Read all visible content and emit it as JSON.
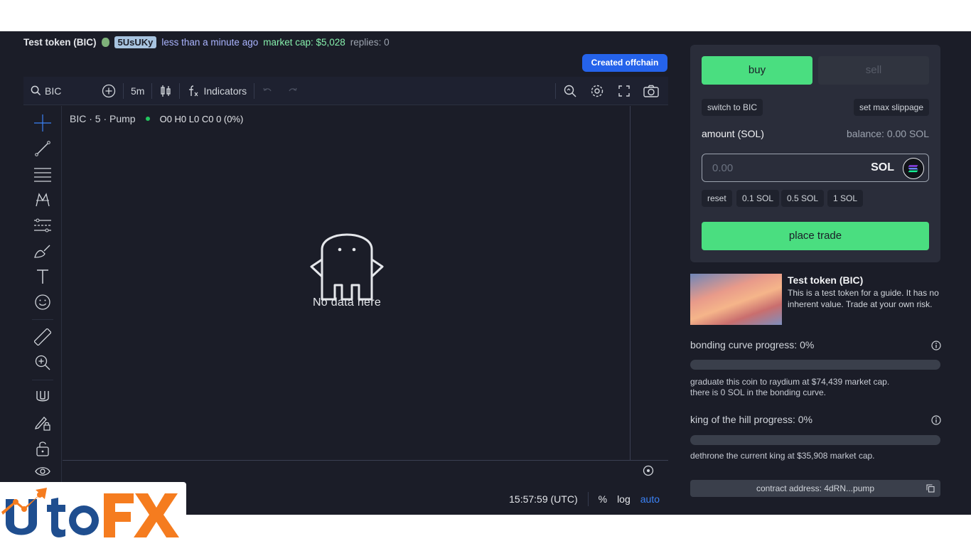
{
  "header": {
    "token_name": "Test token (BIC)",
    "creator": "5UsUKy",
    "created": "less than a minute ago",
    "market_cap": "market cap: $5,028",
    "replies": "replies: 0",
    "offchain_label": "Created offchain"
  },
  "toolbar": {
    "symbol": "BIC",
    "interval": "5m",
    "indicators_label": "Indicators"
  },
  "chart": {
    "legend_title": "BIC · 5 · Pump",
    "ohlc": "O0 H0 L0 C0 0 (0%)",
    "empty_text": "No data here",
    "clock": "15:57:59 (UTC)",
    "percent_label": "%",
    "log_label": "log",
    "auto_label": "auto"
  },
  "trade": {
    "buy_label": "buy",
    "sell_label": "sell",
    "switch_label": "switch to BIC",
    "slippage_label": "set max slippage",
    "amount_label": "amount (SOL)",
    "balance_label": "balance: 0.00 SOL",
    "amount_placeholder": "0.00",
    "currency": "SOL",
    "quick_amounts": [
      "reset",
      "0.1 SOL",
      "0.5 SOL",
      "1 SOL"
    ],
    "place_label": "place trade"
  },
  "token": {
    "title": "Test token (BIC)",
    "description": "This is a test token for a guide. It has no inherent value. Trade at your own risk."
  },
  "bonding": {
    "label": "bonding curve progress: 0%",
    "progress": 0,
    "note_1": "graduate this coin to raydium at $74,439 market cap.",
    "note_2": "there is 0 SOL in the bonding curve."
  },
  "king": {
    "label": "king of the hill progress: 0%",
    "progress": 0,
    "note": "dethrone the current king at $35,908 market cap."
  },
  "contract": {
    "label": "contract address: 4dRN...pump"
  },
  "colors": {
    "background": "#1b1d28",
    "accent_green": "#4ade80",
    "accent_blue": "#2563eb",
    "panel": "#2a2d3a"
  },
  "icons": [
    "search-icon",
    "plus-circle-icon",
    "candles-icon",
    "fx-icon",
    "undo-icon",
    "redo-icon",
    "search-zoom-icon",
    "settings-icon",
    "fullscreen-icon",
    "camera-icon",
    "crosshair-icon",
    "trendline-icon",
    "horizontal-lines-icon",
    "pattern-icon",
    "forecast-icon",
    "brush-icon",
    "text-icon",
    "emoji-icon",
    "ruler-icon",
    "zoom-in-icon",
    "magnet-icon",
    "lock-pencil-icon",
    "lock-icon",
    "eye-icon",
    "ghost-icon",
    "info-icon",
    "copy-icon"
  ],
  "watermark": {
    "brand": "UtoFX"
  }
}
